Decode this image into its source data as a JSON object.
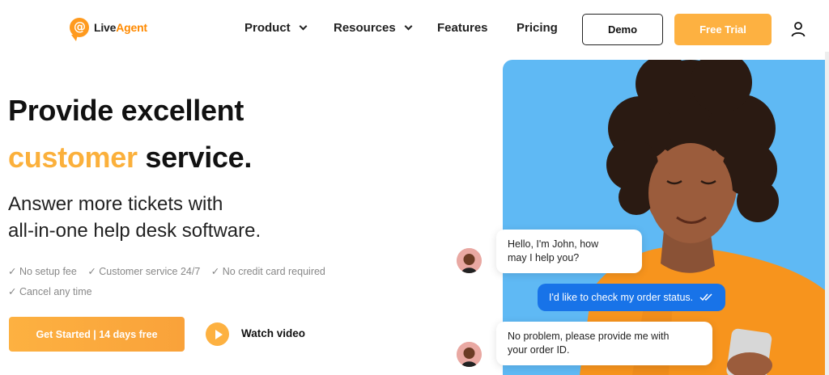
{
  "brand": {
    "name_part1": "Live",
    "name_part2": "Agent"
  },
  "nav": {
    "product": "Product",
    "resources": "Resources",
    "features": "Features",
    "pricing": "Pricing",
    "demo": "Demo",
    "free_trial": "Free Trial"
  },
  "hero": {
    "title_line1": "Provide excellent",
    "title_accent": "customer",
    "title_rest": " service.",
    "subtitle_line1": "Answer more tickets with",
    "subtitle_line2": "all-in-one help desk software.",
    "checks": [
      "✓ No setup fee",
      "✓ Customer service 24/7",
      "✓ No credit card required",
      "✓ Cancel any time"
    ],
    "cta": "Get Started | 14 days free",
    "watch": "Watch video"
  },
  "chat": {
    "msg1_line1": "Hello, I'm John, how",
    "msg1_line2": "may I help you?",
    "msg2": "I'd like to check my order status.",
    "msg3_line1": "No problem, please provide me with",
    "msg3_line2": "your order ID."
  },
  "colors": {
    "accent": "#fbb03b",
    "chat_blue": "#1873e8",
    "hero_bg": "#5fb9f4"
  },
  "icons": [
    "user-icon",
    "chevron-down-icon",
    "play-icon",
    "double-check-icon"
  ]
}
